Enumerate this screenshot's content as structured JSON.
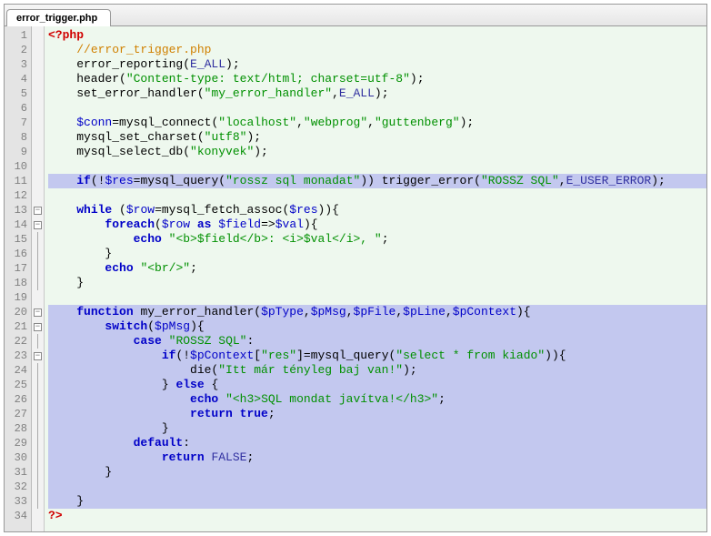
{
  "tab": {
    "label": "error_trigger.php"
  },
  "line_count": 34,
  "fold_starts": [
    13,
    14,
    20,
    21,
    23
  ],
  "highlighted_lines": [
    11,
    20,
    21,
    22,
    23,
    24,
    25,
    26,
    27,
    28,
    29,
    30,
    31,
    32,
    33
  ],
  "code": [
    [
      {
        "c": "tk-tag",
        "t": "<?php"
      }
    ],
    [
      {
        "c": "tk-plain",
        "t": "    "
      },
      {
        "c": "tk-cmt",
        "t": "//error_trigger.php"
      }
    ],
    [
      {
        "c": "tk-plain",
        "t": "    error_reporting("
      },
      {
        "c": "tk-const",
        "t": "E_ALL"
      },
      {
        "c": "tk-plain",
        "t": ");"
      }
    ],
    [
      {
        "c": "tk-plain",
        "t": "    header("
      },
      {
        "c": "tk-str",
        "t": "\"Content-type: text/html; charset=utf-8\""
      },
      {
        "c": "tk-plain",
        "t": ");"
      }
    ],
    [
      {
        "c": "tk-plain",
        "t": "    set_error_handler("
      },
      {
        "c": "tk-str",
        "t": "\"my_error_handler\""
      },
      {
        "c": "tk-plain",
        "t": ","
      },
      {
        "c": "tk-const",
        "t": "E_ALL"
      },
      {
        "c": "tk-plain",
        "t": ");"
      }
    ],
    [
      {
        "c": "tk-plain",
        "t": ""
      }
    ],
    [
      {
        "c": "tk-plain",
        "t": "    "
      },
      {
        "c": "tk-var",
        "t": "$conn"
      },
      {
        "c": "tk-plain",
        "t": "=mysql_connect("
      },
      {
        "c": "tk-str",
        "t": "\"localhost\""
      },
      {
        "c": "tk-plain",
        "t": ","
      },
      {
        "c": "tk-str",
        "t": "\"webprog\""
      },
      {
        "c": "tk-plain",
        "t": ","
      },
      {
        "c": "tk-str",
        "t": "\"guttenberg\""
      },
      {
        "c": "tk-plain",
        "t": ");"
      }
    ],
    [
      {
        "c": "tk-plain",
        "t": "    mysql_set_charset("
      },
      {
        "c": "tk-str",
        "t": "\"utf8\""
      },
      {
        "c": "tk-plain",
        "t": ");"
      }
    ],
    [
      {
        "c": "tk-plain",
        "t": "    mysql_select_db("
      },
      {
        "c": "tk-str",
        "t": "\"konyvek\""
      },
      {
        "c": "tk-plain",
        "t": ");"
      }
    ],
    [
      {
        "c": "tk-plain",
        "t": ""
      }
    ],
    [
      {
        "c": "tk-plain",
        "t": "    "
      },
      {
        "c": "tk-kw",
        "t": "if"
      },
      {
        "c": "tk-plain",
        "t": "(!"
      },
      {
        "c": "tk-var",
        "t": "$res"
      },
      {
        "c": "tk-plain",
        "t": "=mysql_query("
      },
      {
        "c": "tk-str",
        "t": "\"rossz sql monadat\""
      },
      {
        "c": "tk-plain",
        "t": ")) trigger_error("
      },
      {
        "c": "tk-str",
        "t": "\"ROSSZ SQL\""
      },
      {
        "c": "tk-plain",
        "t": ","
      },
      {
        "c": "tk-const",
        "t": "E_USER_ERROR"
      },
      {
        "c": "tk-plain",
        "t": ");"
      }
    ],
    [
      {
        "c": "tk-plain",
        "t": ""
      }
    ],
    [
      {
        "c": "tk-plain",
        "t": "    "
      },
      {
        "c": "tk-kw",
        "t": "while"
      },
      {
        "c": "tk-plain",
        "t": " ("
      },
      {
        "c": "tk-var",
        "t": "$row"
      },
      {
        "c": "tk-plain",
        "t": "=mysql_fetch_assoc("
      },
      {
        "c": "tk-var",
        "t": "$res"
      },
      {
        "c": "tk-plain",
        "t": ")){"
      }
    ],
    [
      {
        "c": "tk-plain",
        "t": "        "
      },
      {
        "c": "tk-kw",
        "t": "foreach"
      },
      {
        "c": "tk-plain",
        "t": "("
      },
      {
        "c": "tk-var",
        "t": "$row"
      },
      {
        "c": "tk-plain",
        "t": " "
      },
      {
        "c": "tk-kw",
        "t": "as"
      },
      {
        "c": "tk-plain",
        "t": " "
      },
      {
        "c": "tk-var",
        "t": "$field"
      },
      {
        "c": "tk-plain",
        "t": "=>"
      },
      {
        "c": "tk-var",
        "t": "$val"
      },
      {
        "c": "tk-plain",
        "t": "){"
      }
    ],
    [
      {
        "c": "tk-plain",
        "t": "            "
      },
      {
        "c": "tk-kw",
        "t": "echo"
      },
      {
        "c": "tk-plain",
        "t": " "
      },
      {
        "c": "tk-str",
        "t": "\"<b>$field</b>: <i>$val</i>, \""
      },
      {
        "c": "tk-plain",
        "t": ";"
      }
    ],
    [
      {
        "c": "tk-plain",
        "t": "        }"
      }
    ],
    [
      {
        "c": "tk-plain",
        "t": "        "
      },
      {
        "c": "tk-kw",
        "t": "echo"
      },
      {
        "c": "tk-plain",
        "t": " "
      },
      {
        "c": "tk-str",
        "t": "\"<br/>\""
      },
      {
        "c": "tk-plain",
        "t": ";"
      }
    ],
    [
      {
        "c": "tk-plain",
        "t": "    }"
      }
    ],
    [
      {
        "c": "tk-plain",
        "t": ""
      }
    ],
    [
      {
        "c": "tk-plain",
        "t": "    "
      },
      {
        "c": "tk-kw",
        "t": "function"
      },
      {
        "c": "tk-plain",
        "t": " my_error_handler("
      },
      {
        "c": "tk-var",
        "t": "$pType"
      },
      {
        "c": "tk-plain",
        "t": ","
      },
      {
        "c": "tk-var",
        "t": "$pMsg"
      },
      {
        "c": "tk-plain",
        "t": ","
      },
      {
        "c": "tk-var",
        "t": "$pFile"
      },
      {
        "c": "tk-plain",
        "t": ","
      },
      {
        "c": "tk-var",
        "t": "$pLine"
      },
      {
        "c": "tk-plain",
        "t": ","
      },
      {
        "c": "tk-var",
        "t": "$pContext"
      },
      {
        "c": "tk-plain",
        "t": "){"
      }
    ],
    [
      {
        "c": "tk-plain",
        "t": "        "
      },
      {
        "c": "tk-kw",
        "t": "switch"
      },
      {
        "c": "tk-plain",
        "t": "("
      },
      {
        "c": "tk-var",
        "t": "$pMsg"
      },
      {
        "c": "tk-plain",
        "t": "){"
      }
    ],
    [
      {
        "c": "tk-plain",
        "t": "            "
      },
      {
        "c": "tk-kw",
        "t": "case"
      },
      {
        "c": "tk-plain",
        "t": " "
      },
      {
        "c": "tk-str",
        "t": "\"ROSSZ SQL\""
      },
      {
        "c": "tk-plain",
        "t": ":"
      }
    ],
    [
      {
        "c": "tk-plain",
        "t": "                "
      },
      {
        "c": "tk-kw",
        "t": "if"
      },
      {
        "c": "tk-plain",
        "t": "(!"
      },
      {
        "c": "tk-var",
        "t": "$pContext"
      },
      {
        "c": "tk-plain",
        "t": "["
      },
      {
        "c": "tk-str",
        "t": "\"res\""
      },
      {
        "c": "tk-plain",
        "t": "]=mysql_query("
      },
      {
        "c": "tk-str",
        "t": "\"select * from kiado\""
      },
      {
        "c": "tk-plain",
        "t": ")){"
      }
    ],
    [
      {
        "c": "tk-plain",
        "t": "                    die("
      },
      {
        "c": "tk-str",
        "t": "\"Itt már tényleg baj van!\""
      },
      {
        "c": "tk-plain",
        "t": ");"
      }
    ],
    [
      {
        "c": "tk-plain",
        "t": "                } "
      },
      {
        "c": "tk-kw",
        "t": "else"
      },
      {
        "c": "tk-plain",
        "t": " {"
      }
    ],
    [
      {
        "c": "tk-plain",
        "t": "                    "
      },
      {
        "c": "tk-kw",
        "t": "echo"
      },
      {
        "c": "tk-plain",
        "t": " "
      },
      {
        "c": "tk-str",
        "t": "\"<h3>SQL mondat javítva!</h3>\""
      },
      {
        "c": "tk-plain",
        "t": ";"
      }
    ],
    [
      {
        "c": "tk-plain",
        "t": "                    "
      },
      {
        "c": "tk-kw",
        "t": "return"
      },
      {
        "c": "tk-plain",
        "t": " "
      },
      {
        "c": "tk-kw",
        "t": "true"
      },
      {
        "c": "tk-plain",
        "t": ";"
      }
    ],
    [
      {
        "c": "tk-plain",
        "t": "                }"
      }
    ],
    [
      {
        "c": "tk-plain",
        "t": "            "
      },
      {
        "c": "tk-kw",
        "t": "default"
      },
      {
        "c": "tk-plain",
        "t": ":"
      }
    ],
    [
      {
        "c": "tk-plain",
        "t": "                "
      },
      {
        "c": "tk-kw",
        "t": "return"
      },
      {
        "c": "tk-plain",
        "t": " "
      },
      {
        "c": "tk-const",
        "t": "FALSE"
      },
      {
        "c": "tk-plain",
        "t": ";"
      }
    ],
    [
      {
        "c": "tk-plain",
        "t": "        }"
      }
    ],
    [
      {
        "c": "tk-plain",
        "t": ""
      }
    ],
    [
      {
        "c": "tk-plain",
        "t": "    }"
      }
    ],
    [
      {
        "c": "tk-tag",
        "t": "?>"
      }
    ]
  ]
}
